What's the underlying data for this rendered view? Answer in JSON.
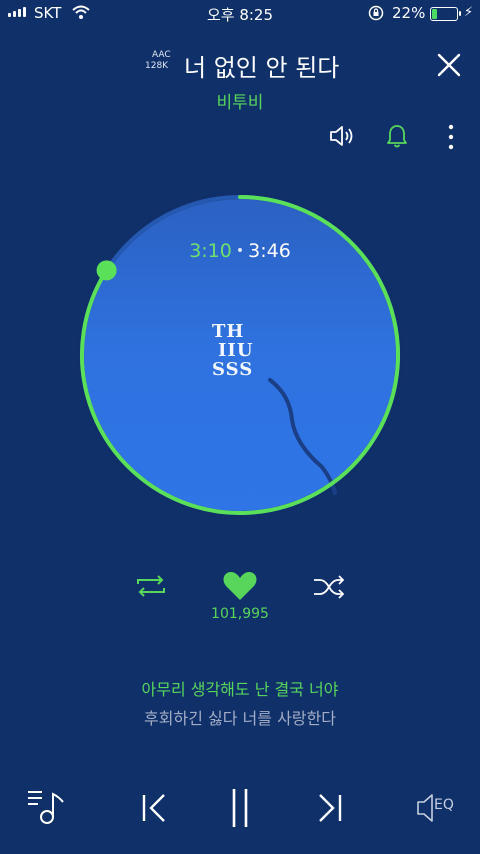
{
  "status_bar": {
    "carrier": "SKT",
    "time": "오후 8:25",
    "battery_percent": "22%",
    "battery_level": 0.22
  },
  "header": {
    "quality_line1": "AAC",
    "quality_line2": "128K",
    "song_title": "너 없인 안 된다",
    "artist": "비투비"
  },
  "player": {
    "current_time": "3:10",
    "total_time": "3:46",
    "progress": 0.84,
    "album_logo_line1": "TH",
    "album_logo_line2": "IIU",
    "album_logo_line3": "SSS"
  },
  "controls": {
    "like_count": "101,995",
    "eq_label": "EQ"
  },
  "lyrics": {
    "current": "아무리 생각해도 난 결국 너야",
    "next": "후회하긴 싫다 너를 사랑한다"
  },
  "colors": {
    "background": "#10306a",
    "accent": "#58d65b",
    "disc": "#2f6fd8"
  },
  "icons": {
    "close": "close-icon",
    "speaker": "speaker-icon",
    "bell": "bell-icon",
    "more": "more-vertical-icon",
    "repeat": "repeat-icon",
    "heart": "heart-icon",
    "shuffle": "shuffle-icon",
    "playlist": "playlist-icon",
    "prev": "previous-icon",
    "pause": "pause-icon",
    "next": "next-icon",
    "eq": "equalizer-icon"
  }
}
